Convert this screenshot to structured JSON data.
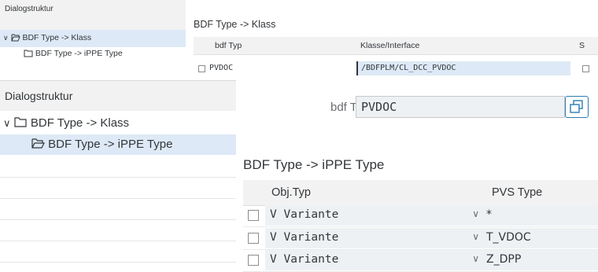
{
  "top": {
    "nav_title": "Dialogstruktur",
    "nav_items": [
      {
        "label": "BDF Type -> Klass"
      },
      {
        "label": "BDF Type -> iPPE Type"
      }
    ],
    "view_title": "BDF Type -> Klass",
    "columns": [
      "bdf Typ",
      "Klasse/Interface",
      "S"
    ],
    "rows": [
      {
        "bdf_typ": "PVDOC",
        "klasse": "/BDFPLM/CL_DCC_PVDOC"
      }
    ]
  },
  "bottom": {
    "nav_title": "Dialogstruktur",
    "nav_items": [
      {
        "label": "BDF Type -> Klass"
      },
      {
        "label": "BDF Type -> iPPE Type"
      }
    ],
    "field_label": "bdf Typ:",
    "field_value": "PVDOC",
    "section_title": "BDF Type -> iPPE Type",
    "columns": [
      "Obj.Typ",
      "PVS Type"
    ],
    "rows": [
      {
        "obj_typ": "V Variante",
        "pvs_type": "*"
      },
      {
        "obj_typ": "V Variante",
        "pvs_type": "T_VDOC"
      },
      {
        "obj_typ": "V Variante",
        "pvs_type": "Z_DPP"
      }
    ]
  },
  "icons": [
    "open-folder-icon",
    "folder-icon",
    "chevron-down-icon",
    "value-help-icon"
  ],
  "colors": {
    "selection": "#dde9f6",
    "header": "#f2f2f2",
    "input_bg": "#eef1f4",
    "link_blue": "#2b7cb3"
  }
}
